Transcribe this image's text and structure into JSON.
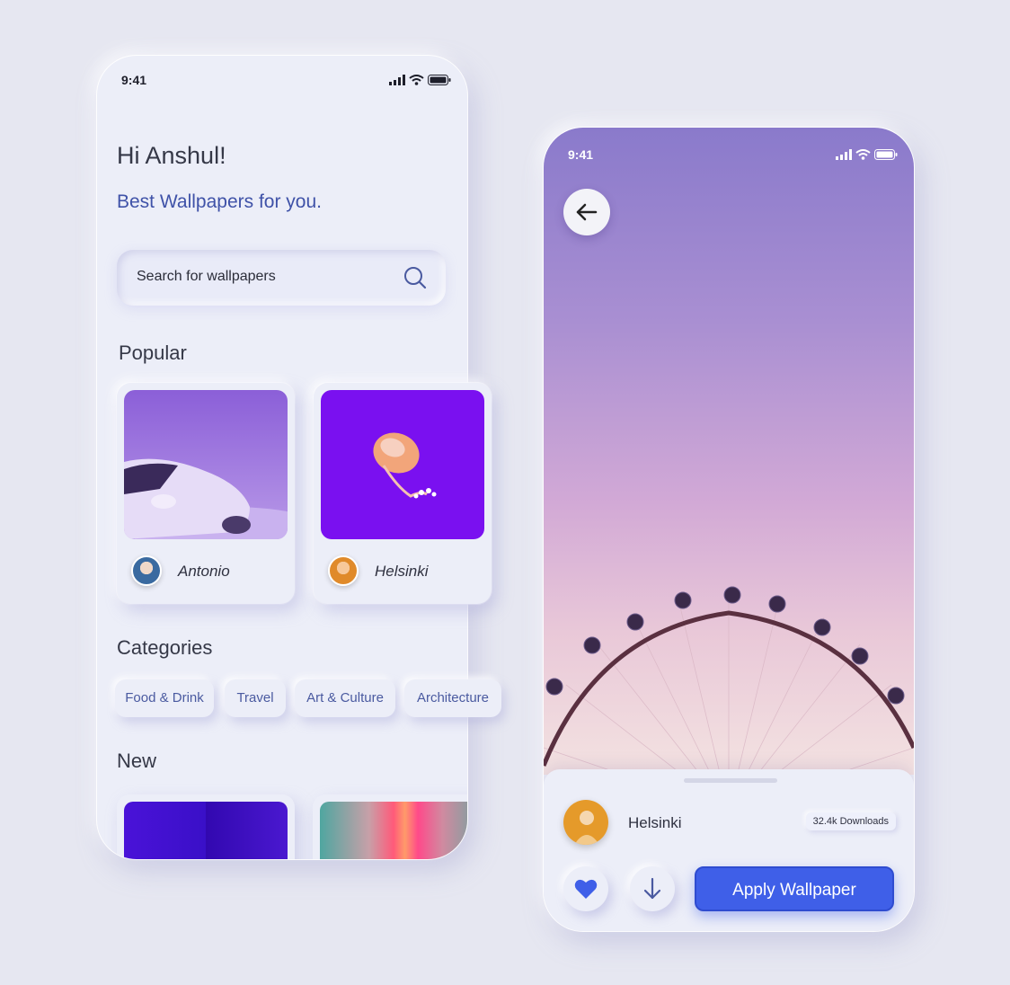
{
  "colors": {
    "accent": "#3f5fe8",
    "tagline": "#3f52a8",
    "bg": "#e6e7f1"
  },
  "home": {
    "status_time": "9:41",
    "greeting": "Hi Anshul!",
    "tagline": "Best Wallpapers for you.",
    "search": {
      "placeholder": "Search for wallpapers",
      "icon": "search-icon"
    },
    "popular_title": "Popular",
    "popular": [
      {
        "author": "Antonio"
      },
      {
        "author": "Helsinki"
      }
    ],
    "categories_title": "Categories",
    "categories": [
      "Food & Drink",
      "Travel",
      "Art & Culture",
      "Architecture"
    ],
    "new_title": "New"
  },
  "detail": {
    "status_time": "9:41",
    "back_icon": "arrow-left-icon",
    "author": "Helsinki",
    "downloads": "32.4k Downloads",
    "like_icon": "heart-icon",
    "download_icon": "arrow-down-icon",
    "apply_label": "Apply Wallpaper"
  }
}
